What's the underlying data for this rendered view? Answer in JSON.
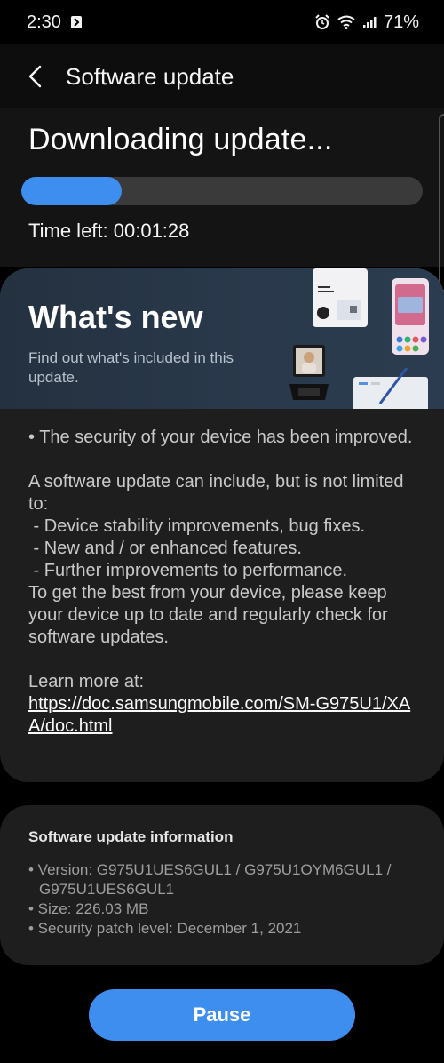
{
  "status_bar": {
    "time": "2:30",
    "battery": "71%",
    "icons": [
      "nfc-icon",
      "alarm-icon",
      "wifi-icon",
      "signal-icon"
    ]
  },
  "header": {
    "title": "Software update",
    "back_icon": "back-arrow-icon"
  },
  "download": {
    "title": "Downloading update...",
    "progress_fraction": 0.25,
    "time_left": "Time left: 00:01:28",
    "accent_color": "#3e8ef0"
  },
  "whats_new": {
    "title": "What's new",
    "subtitle": "Find out what's included in this update.",
    "body": {
      "security": "• The security of your device has been improved.",
      "intro": "A software update can include, but is not limited to:",
      "items": [
        " - Device stability improvements, bug fixes.",
        " - New and / or enhanced features.",
        " - Further improvements to performance."
      ],
      "advice": "To get the best from your device, please keep your device up to date and regularly check for software updates.",
      "learn_more": "Learn more at:",
      "link": "https://doc.samsungmobile.com/SM-G975U1/XAA/doc.html"
    }
  },
  "info": {
    "title": "Software update information",
    "items": [
      "• Version: G975U1UES6GUL1 / G975U1OYM6GUL1 / G975U1UES6GUL1",
      "• Size: 226.03 MB",
      "• Security patch level: December 1, 2021"
    ]
  },
  "actions": {
    "pause_label": "Pause"
  }
}
